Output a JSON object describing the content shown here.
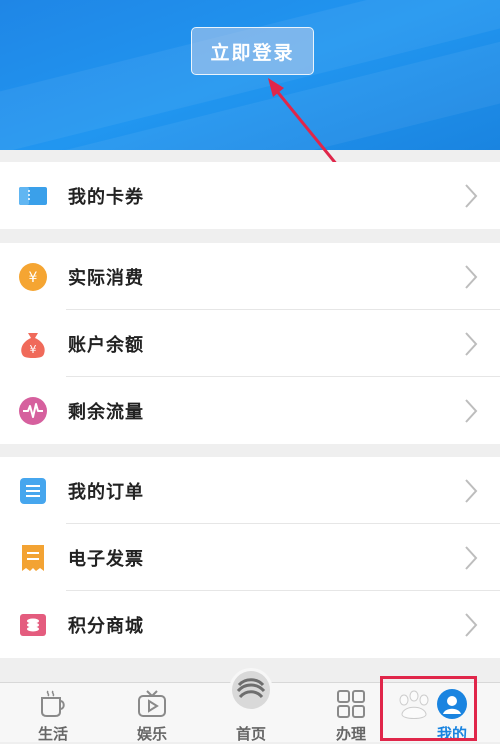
{
  "header": {
    "login_label": "立即登录"
  },
  "sections": [
    {
      "items": [
        {
          "label": "我的卡券",
          "icon": "ticket-icon"
        }
      ]
    },
    {
      "items": [
        {
          "label": "实际消费",
          "icon": "yen-coin-icon"
        },
        {
          "label": "账户余额",
          "icon": "money-bag-icon"
        },
        {
          "label": "剩余流量",
          "icon": "signal-wave-icon"
        }
      ]
    },
    {
      "items": [
        {
          "label": "我的订单",
          "icon": "order-list-icon"
        },
        {
          "label": "电子发票",
          "icon": "invoice-icon"
        },
        {
          "label": "积分商城",
          "icon": "points-mall-icon"
        }
      ]
    }
  ],
  "tabbar": {
    "items": [
      {
        "label": "生活",
        "icon": "coffee-cup-icon"
      },
      {
        "label": "娱乐",
        "icon": "tv-play-icon"
      },
      {
        "label": "首页",
        "icon": "china-mobile-logo-icon"
      },
      {
        "label": "办理",
        "icon": "grid-apps-icon"
      },
      {
        "label": "我的",
        "icon": "user-avatar-icon"
      }
    ],
    "active": "我的"
  },
  "colors": {
    "header_blue": "#1f8ae6",
    "annotation_red": "#e0264a",
    "active_tab": "#1a84e0"
  }
}
